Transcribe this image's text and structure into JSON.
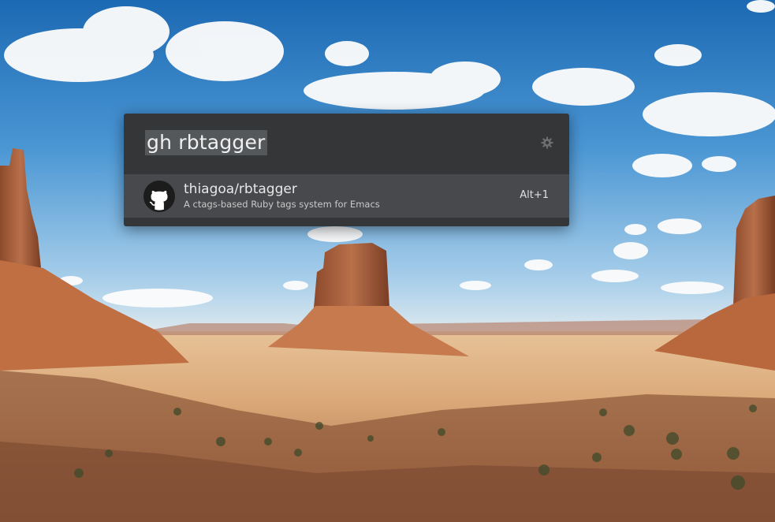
{
  "launcher": {
    "query": "gh rbtagger",
    "preferences_icon": "gear-icon",
    "results": [
      {
        "title": "thiagoa/rbtagger",
        "description": "A ctags-based Ruby tags system for Emacs",
        "shortcut": "Alt+1",
        "icon": "github-icon"
      }
    ]
  },
  "colors": {
    "window_bg": "#343638",
    "selected_item_bg": "#47494c",
    "query_highlight": "#55585b",
    "text_primary": "#e8e8e8",
    "text_secondary": "#c9c9c9"
  }
}
